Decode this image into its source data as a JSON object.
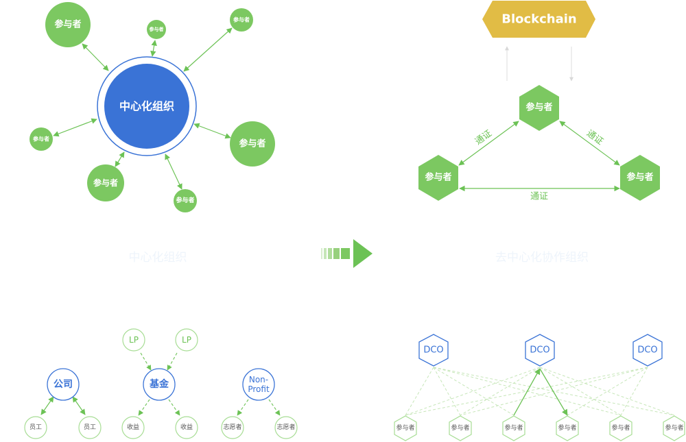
{
  "left_top": {
    "center_label": "中心化组织",
    "participant_label": "参与者"
  },
  "right_top": {
    "blockchain_label": "Blockchain",
    "participant_label": "参与者",
    "edge_label": "通证"
  },
  "middle": {
    "left_caption": "中心化组织",
    "right_caption": "去中心化协作组织"
  },
  "left_bottom": {
    "company_label": "公司",
    "employee_label": "员工",
    "fund_label": "基金",
    "lp_label": "LP",
    "income_label": "收益",
    "nonprofit_label_1": "Non-",
    "nonprofit_label_2": "Profit",
    "volunteer_label": "志愿者"
  },
  "right_bottom": {
    "dco_label": "DCO",
    "participant_label": "参与者"
  },
  "colors": {
    "green": "#7cc861",
    "blue": "#3a73d6",
    "gold": "#e1bc45",
    "light_green": "#a7dd94"
  }
}
